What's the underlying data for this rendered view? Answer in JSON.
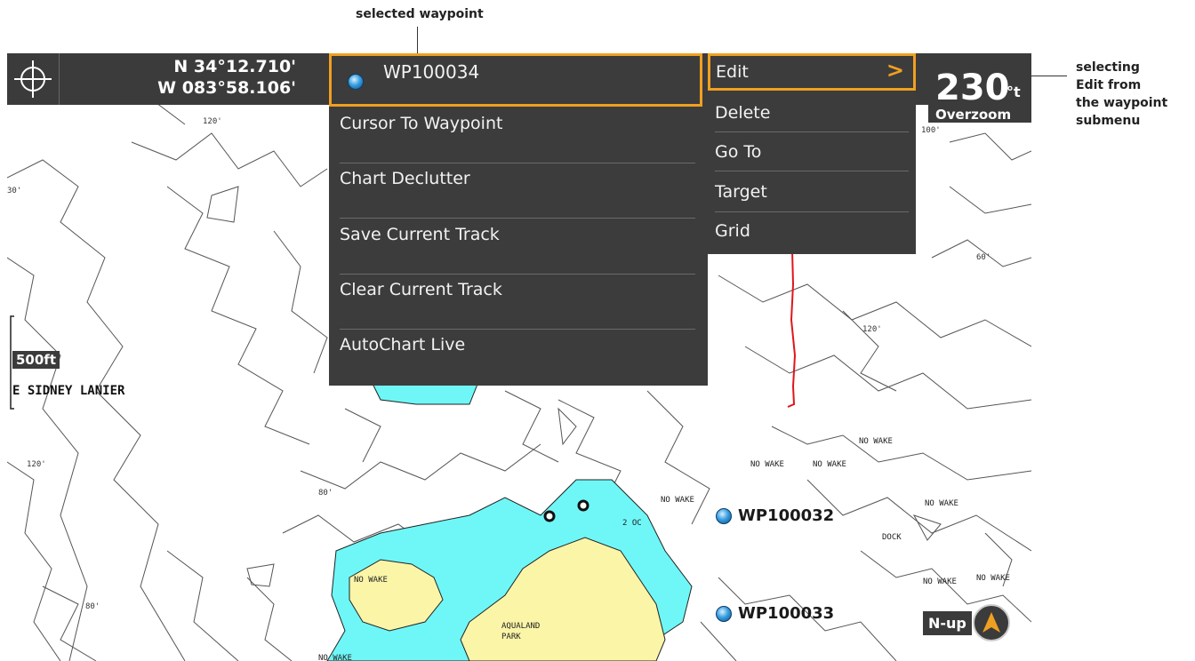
{
  "annotations": {
    "selected_waypoint": "selected waypoint",
    "selecting_line1": "selecting",
    "selecting_line2": "Edit from",
    "selecting_line3": "the waypoint",
    "selecting_line4": "submenu"
  },
  "position": {
    "lat": "N 34°12.710'",
    "lon": "W 083°58.106'"
  },
  "heading": {
    "value": "230",
    "unit": "°t",
    "zoom_label": "Overzoom"
  },
  "scale": {
    "label": "500ft"
  },
  "lake_label": "E SIDNEY LANIER",
  "menu": {
    "selected_waypoint": "WP100034",
    "items": [
      "Cursor To Waypoint",
      "Chart Declutter",
      "Save Current Track",
      "Clear Current Track",
      "AutoChart Live"
    ]
  },
  "submenu": {
    "items": [
      "Edit",
      "Delete",
      "Go To",
      "Target",
      "Grid"
    ],
    "arrow": ">"
  },
  "waypoints": [
    "WP100032",
    "WP100033"
  ],
  "orientation": "N-up",
  "map_labels": {
    "no_wake": "NO WAKE",
    "dock": "DOCK",
    "aqualand_1": "AQUALAND",
    "aqualand_2": "PARK",
    "marker_2oc": "2 OC"
  },
  "depths": {
    "d120": "120'",
    "d80": "80'",
    "d60": "60'",
    "d30": "30'",
    "d100": "100'"
  },
  "colors": {
    "water_shallow": "#6ff7f7",
    "land": "#fbf5a8",
    "accent_orange": "#f0a020",
    "panel": "#3c3c3c",
    "track": "#e0151a"
  }
}
